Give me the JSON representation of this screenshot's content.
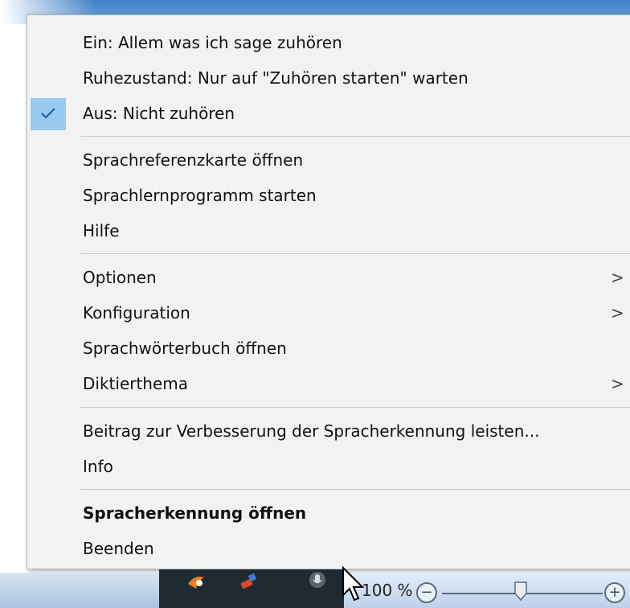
{
  "menu": {
    "listening": [
      {
        "label": "Ein: Allem was ich sage zuhören",
        "checked": false
      },
      {
        "label": "Ruhezustand: Nur auf \"Zuhören starten\" warten",
        "checked": false
      },
      {
        "label": "Aus: Nicht zuhören",
        "checked": true
      }
    ],
    "help": [
      {
        "label": "Sprachreferenzkarte öffnen"
      },
      {
        "label": "Sprachlernprogramm starten"
      },
      {
        "label": "Hilfe"
      }
    ],
    "config": [
      {
        "label": "Optionen",
        "submenu": true
      },
      {
        "label": "Konfiguration",
        "submenu": true
      },
      {
        "label": "Sprachwörterbuch öffnen",
        "submenu": false
      },
      {
        "label": "Diktierthema",
        "submenu": true
      }
    ],
    "contribute": [
      {
        "label": "Beitrag zur Verbesserung der Spracherkennung leisten..."
      },
      {
        "label": "Info"
      }
    ],
    "app": [
      {
        "label": "Spracherkennung öffnen",
        "bold": true
      },
      {
        "label": "Beenden"
      }
    ],
    "submenu_arrow": ">"
  },
  "statusbar": {
    "zoom_text": "100 %",
    "zoom_minus": "−",
    "zoom_plus": "+",
    "zoom_level_percent": 100
  },
  "colors": {
    "menu_bg": "#f2f2f2",
    "check_highlight": "#99c9ef",
    "check_mark": "#1c5c9c"
  }
}
